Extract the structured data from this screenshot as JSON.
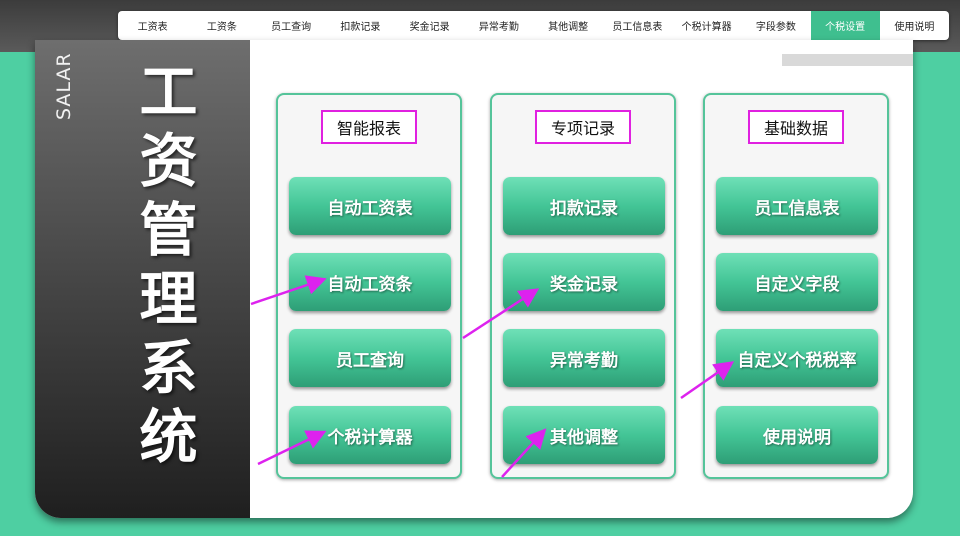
{
  "nav": {
    "items": [
      "工资表",
      "工资条",
      "员工查询",
      "扣款记录",
      "奖金记录",
      "异常考勤",
      "其他调整",
      "员工信息表",
      "个税计算器",
      "字段参数",
      "个税设置",
      "使用说明"
    ],
    "active": "个税设置"
  },
  "sidebar": {
    "vertical_text": "SALAR",
    "title_chars": [
      "工",
      "资",
      "管",
      "理",
      "系",
      "统"
    ]
  },
  "groups": [
    {
      "title": "智能报表",
      "buttons": [
        "自动工资表",
        "自动工资条",
        "员工查询",
        "个税计算器"
      ]
    },
    {
      "title": "专项记录",
      "buttons": [
        "扣款记录",
        "奖金记录",
        "异常考勤",
        "其他调整"
      ]
    },
    {
      "title": "基础数据",
      "buttons": [
        "员工信息表",
        "自定义字段",
        "自定义个税税率",
        "使用说明"
      ]
    }
  ],
  "colors": {
    "background": "#4ecfa2",
    "accent": "#3fbf8f",
    "title_border": "#e020e0",
    "arrow": "#dd22ee"
  }
}
